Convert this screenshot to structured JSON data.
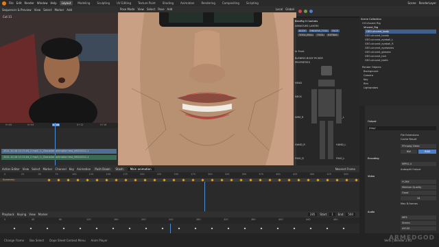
{
  "topbar": {
    "menus": [
      "File",
      "Edit",
      "Render",
      "Window",
      "Help"
    ],
    "workspaces": [
      "Layout",
      "Modeling",
      "Sculpting",
      "UV Editing",
      "Texture Paint",
      "Shading",
      "Animation",
      "Rendering",
      "Compositing",
      "Scripting"
    ],
    "active_workspace": "Layout",
    "scene": "Scene",
    "view_layer": "RenderLayer"
  },
  "left_panel": {
    "header_items": [
      "Sequencer & Preview",
      "View",
      "Select",
      "Marker",
      "Add"
    ],
    "camera_label": "Cut 11",
    "ruler_ticks": [
      "0+00",
      "0+04",
      "0+08",
      "0+12",
      "0+16"
    ],
    "strips": [
      {
        "label": "2021-10-16 12:13-04_2 mp4 | 1_Character animation test_06012021-1",
        "color": "#4e6f91"
      },
      {
        "label": "2021-10-16 12:13-04_2 mp4 | 1_Character animation test_06012021-1",
        "color": "#3b6a55"
      }
    ]
  },
  "viewport": {
    "header_items": [
      "Pose Mode",
      "View",
      "Select",
      "Pose",
      "Add",
      "Local",
      "Global"
    ],
    "overlay_label": "BlenRig 5 Controls"
  },
  "rig_panel": {
    "title": "BlenRig 5 Controls",
    "sections": [
      "ARMATURE LAYERS",
      "PROPERTIES",
      "BLENRIG BODY PICKER"
    ],
    "layer_buttons": [
      "BODY",
      "FINGERS_TOOL",
      "FACE",
      "TOOL_ROLL",
      "TOOL",
      "EXTRAS"
    ],
    "labels": [
      "HEAD",
      "NECK",
      "ARM_R",
      "ARM_L",
      "HAND_R",
      "HAND_L",
      "FING_R",
      "FING_L"
    ],
    "in_front": "In Front"
  },
  "outliner": {
    "items": [
      "Scene Collection",
      "CH-Vincent Rig",
      "Vincent_Rig",
      "GEO-vincent_body",
      "GEO-vincent_hands",
      "GEO-vincent_eyeball_L",
      "GEO-vincent_eyeball_R",
      "GEO-vincent_eyelashes",
      "GEO-vincent_glasses",
      "GEO-vincent_hair",
      "GEO-vincent_teeth",
      "Render Objects",
      "Background",
      "Camera",
      "Key",
      "Rim",
      "Lightprobes"
    ]
  },
  "properties": {
    "output_title": "Output",
    "output_path": "/tmp/",
    "saving": [
      "File Extensions",
      "Cache Result"
    ],
    "file_format": "FFmpeg Video",
    "color": [
      "BW",
      "RGB"
    ],
    "encoding": "Encoding",
    "container": "MPEG-4",
    "autosplit": "Autosplit Output",
    "video": "Video",
    "video_codec": "H.264",
    "output_quality": "Medium Quality",
    "encoding_speed": "Good",
    "keyframe_interval": "18",
    "max_bframes": "Max B-frames",
    "audio": "Audio",
    "audio_codec": "MP3",
    "audio_channels": "Stereo",
    "sample_rate": "44100"
  },
  "dope_sheet": {
    "header_items": [
      "Action Editor",
      "View",
      "Select",
      "Marker",
      "Channel",
      "Key",
      "Animation"
    ],
    "action_name": "Main animation",
    "summary_label": "Summary",
    "push_down": "Push Down",
    "stash": "Stash",
    "nearest_frame": "Nearest Frame",
    "ruler_ticks": [
      "0",
      "25",
      "50",
      "75",
      "100",
      "125",
      "150",
      "175",
      "200",
      "225",
      "250",
      "275",
      "300",
      "325",
      "350",
      "375",
      "400",
      "425",
      "450",
      "475",
      "500"
    ],
    "current_frame": "285"
  },
  "timeline": {
    "header_items": [
      "Playback",
      "Keying",
      "View",
      "Marker"
    ],
    "start_label": "Start",
    "start": "1",
    "end_label": "End",
    "end": "500",
    "current_frame": "285",
    "ruler_ticks": [
      "0",
      "40",
      "80",
      "120",
      "160",
      "200",
      "240",
      "280",
      "320",
      "360",
      "400",
      "440",
      "480"
    ]
  },
  "status_bar": {
    "items": [
      "Change Frame",
      "Box Select",
      "Dope Sheet Context Menu",
      "Anim Player"
    ],
    "version": "Verts | Blender 2.93"
  },
  "watermark": "ARMEDGOD",
  "colors": {
    "accent": "#e87d0d",
    "playhead": "#4f8fd8",
    "keyframe": "#e3a21b",
    "selection": "#3f5f8f"
  }
}
